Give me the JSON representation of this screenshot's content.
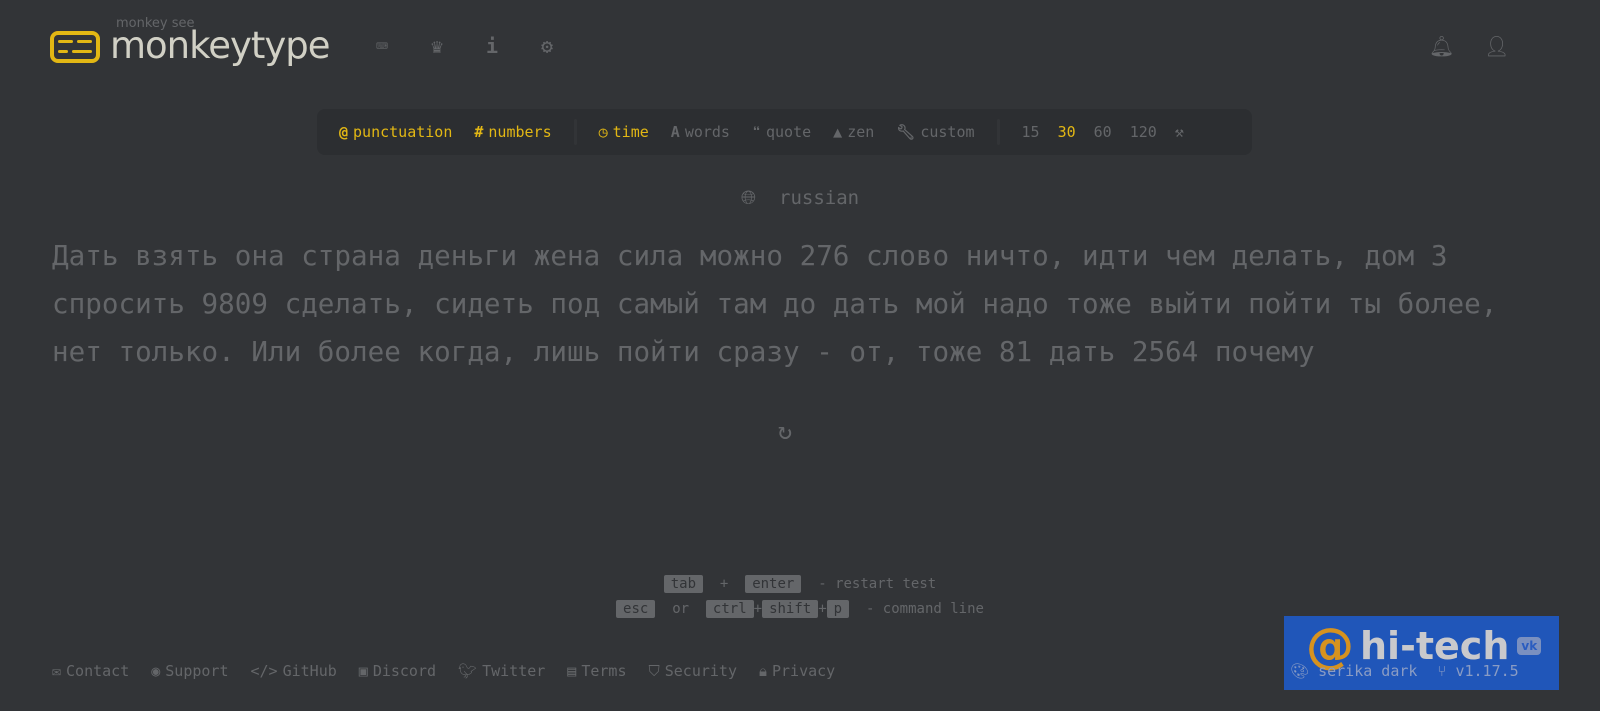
{
  "header": {
    "subtitle": "monkey see",
    "title": "monkeytype"
  },
  "modes": {
    "punctuation": "punctuation",
    "numbers": "numbers",
    "time": "time",
    "words": "words",
    "quote": "quote",
    "zen": "zen",
    "custom": "custom",
    "durations": [
      "15",
      "30",
      "60",
      "120"
    ],
    "selected_duration": "30"
  },
  "language": "russian",
  "words": "Дать взять она страна деньги жена сила можно 276 слово ничто, идти чем делать, дом 3 спросить 9809 сделать, сидеть под самый там до дать мой надо тоже выйти пойти ты более, нет только. Или более когда, лишь пойти сразу - от, тоже 81 дать 2564 почему",
  "shortcuts": {
    "tab": "tab",
    "plus": "+",
    "enter": "enter",
    "restart": "- restart test",
    "esc": "esc",
    "or": "or",
    "ctrl": "ctrl",
    "shift": "shift",
    "p": "p",
    "command": "- command line"
  },
  "footer": [
    "Contact",
    "Support",
    "GitHub",
    "Discord",
    "Twitter",
    "Terms",
    "Security",
    "Privacy"
  ],
  "theme": "serika dark",
  "version": "v1.17.5",
  "watermark": {
    "text": "hi-tech",
    "badge": "vk"
  },
  "colors": {
    "bg": "#323437",
    "accent": "#e2b714",
    "sub": "#646669",
    "text": "#d1d0c5"
  }
}
